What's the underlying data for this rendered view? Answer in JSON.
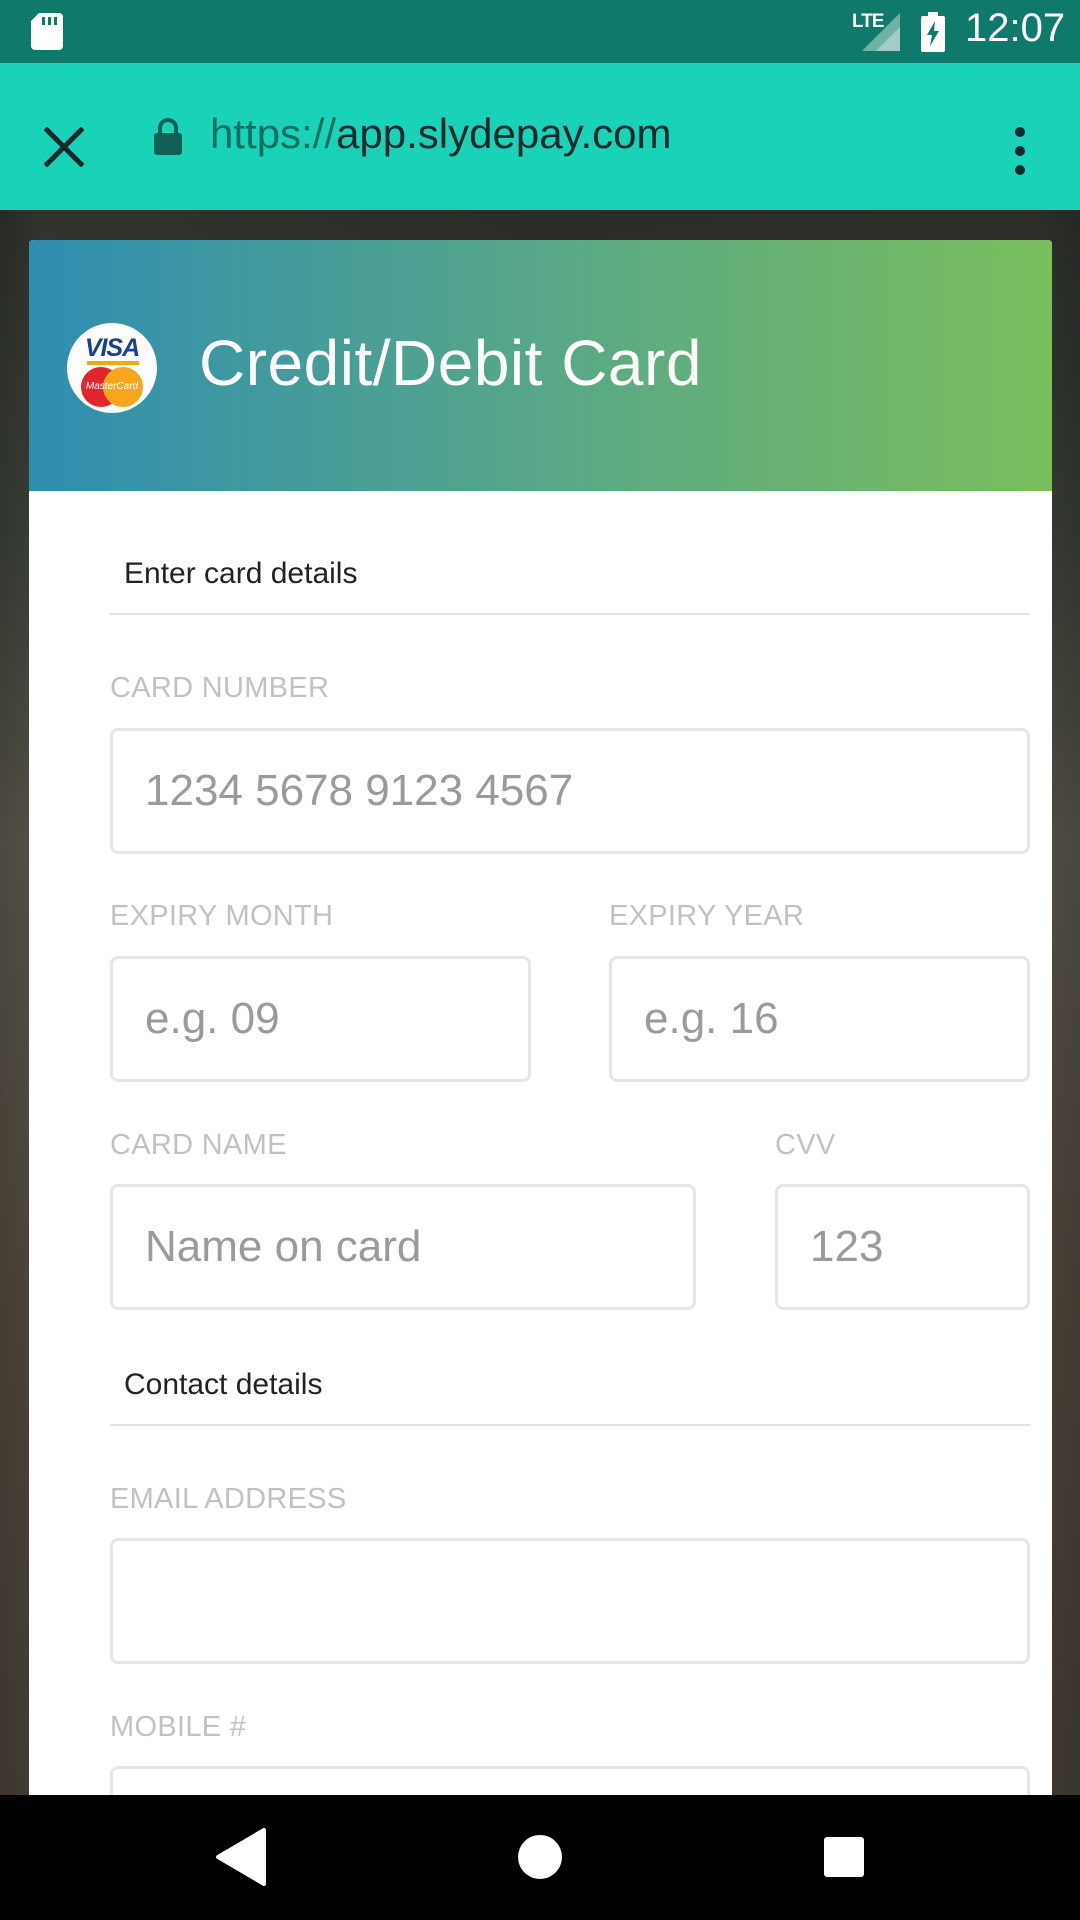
{
  "status_bar": {
    "network": "LTE",
    "time": "12:07"
  },
  "browser": {
    "url_scheme": "https://",
    "url_host": "app.slydepay.com"
  },
  "card": {
    "title": "Credit/Debit Card",
    "logo": "visa-mastercard-logo"
  },
  "sections": {
    "card_details": "Enter card details",
    "contact_details": "Contact details"
  },
  "fields": {
    "card_number": {
      "label": "CARD NUMBER",
      "placeholder": "1234 5678 9123 4567"
    },
    "expiry_month": {
      "label": "EXPIRY MONTH",
      "placeholder": "e.g. 09"
    },
    "expiry_year": {
      "label": "EXPIRY YEAR",
      "placeholder": "e.g. 16"
    },
    "card_name": {
      "label": "CARD NAME",
      "placeholder": "Name on card"
    },
    "cvv": {
      "label": "CVV",
      "placeholder": "123"
    },
    "email": {
      "label": "EMAIL ADDRESS",
      "placeholder": ""
    },
    "mobile": {
      "label": "MOBILE #",
      "placeholder": ""
    }
  },
  "colors": {
    "status_bar": "#0f7a6c",
    "url_bar": "#19d2b8",
    "header_gradient_start": "#2f8db0",
    "header_gradient_end": "#7abe5d"
  }
}
